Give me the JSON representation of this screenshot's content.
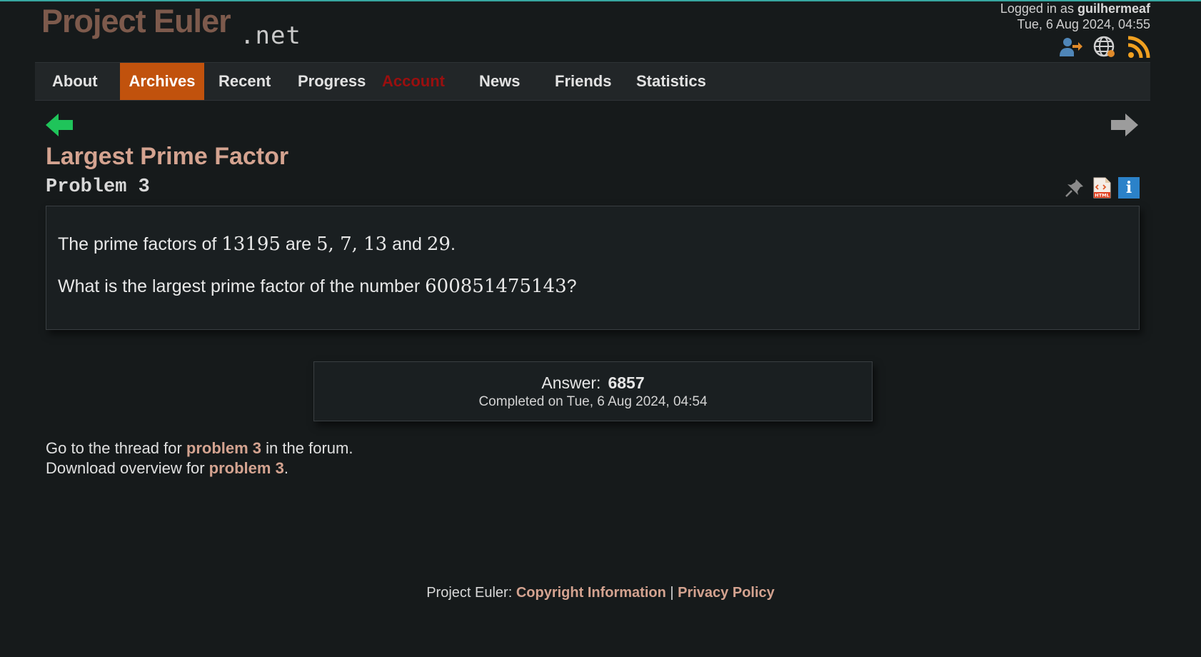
{
  "logo": {
    "main": "Project Euler",
    "suffix": ".net"
  },
  "user": {
    "prefix": "Logged in as",
    "username": "guilhermeaf",
    "datetime": "Tue, 6 Aug 2024, 04:55"
  },
  "top_icons": [
    "account-switch-icon",
    "language-globe-icon",
    "rss-icon"
  ],
  "nav": {
    "items": [
      {
        "label": "About",
        "active": false
      },
      {
        "label": "Archives",
        "active": true
      },
      {
        "label": "Recent",
        "active": false
      },
      {
        "label": "Progress",
        "active": false
      },
      {
        "label": "Account",
        "active": false
      },
      {
        "label": "News",
        "active": false
      },
      {
        "label": "Friends",
        "active": false
      },
      {
        "label": "Statistics",
        "active": false
      }
    ]
  },
  "problem": {
    "title": "Largest Prime Factor",
    "number_label": "Problem 3",
    "icons": [
      "pin-icon",
      "html-file-icon",
      "info-icon"
    ],
    "info_glyph": "i",
    "p1": {
      "pre": "The prime factors of ",
      "n": "13195",
      "mid": " are ",
      "factors": "5, 7, 13",
      "and": " and ",
      "last": "29",
      "end": "."
    },
    "p2": {
      "pre": "What is the largest prime factor of the number ",
      "n": "600851475143",
      "end": "?"
    }
  },
  "answer": {
    "label": "Answer:",
    "value": "6857",
    "completed": "Completed on Tue, 6 Aug 2024, 04:54"
  },
  "forum": {
    "line1_pre": "Go to the thread for ",
    "line1_link": "problem 3",
    "line1_post": " in the forum.",
    "line2_pre": "Download overview for ",
    "line2_link": "problem 3",
    "line2_post": "."
  },
  "footer": {
    "prefix": "Project Euler: ",
    "copyright": "Copyright Information",
    "separator": " | ",
    "privacy": "Privacy Policy"
  },
  "colors": {
    "accent": "#c1520d",
    "title": "#d4a390",
    "background": "#161a1b",
    "account": "#9a0f0f"
  }
}
